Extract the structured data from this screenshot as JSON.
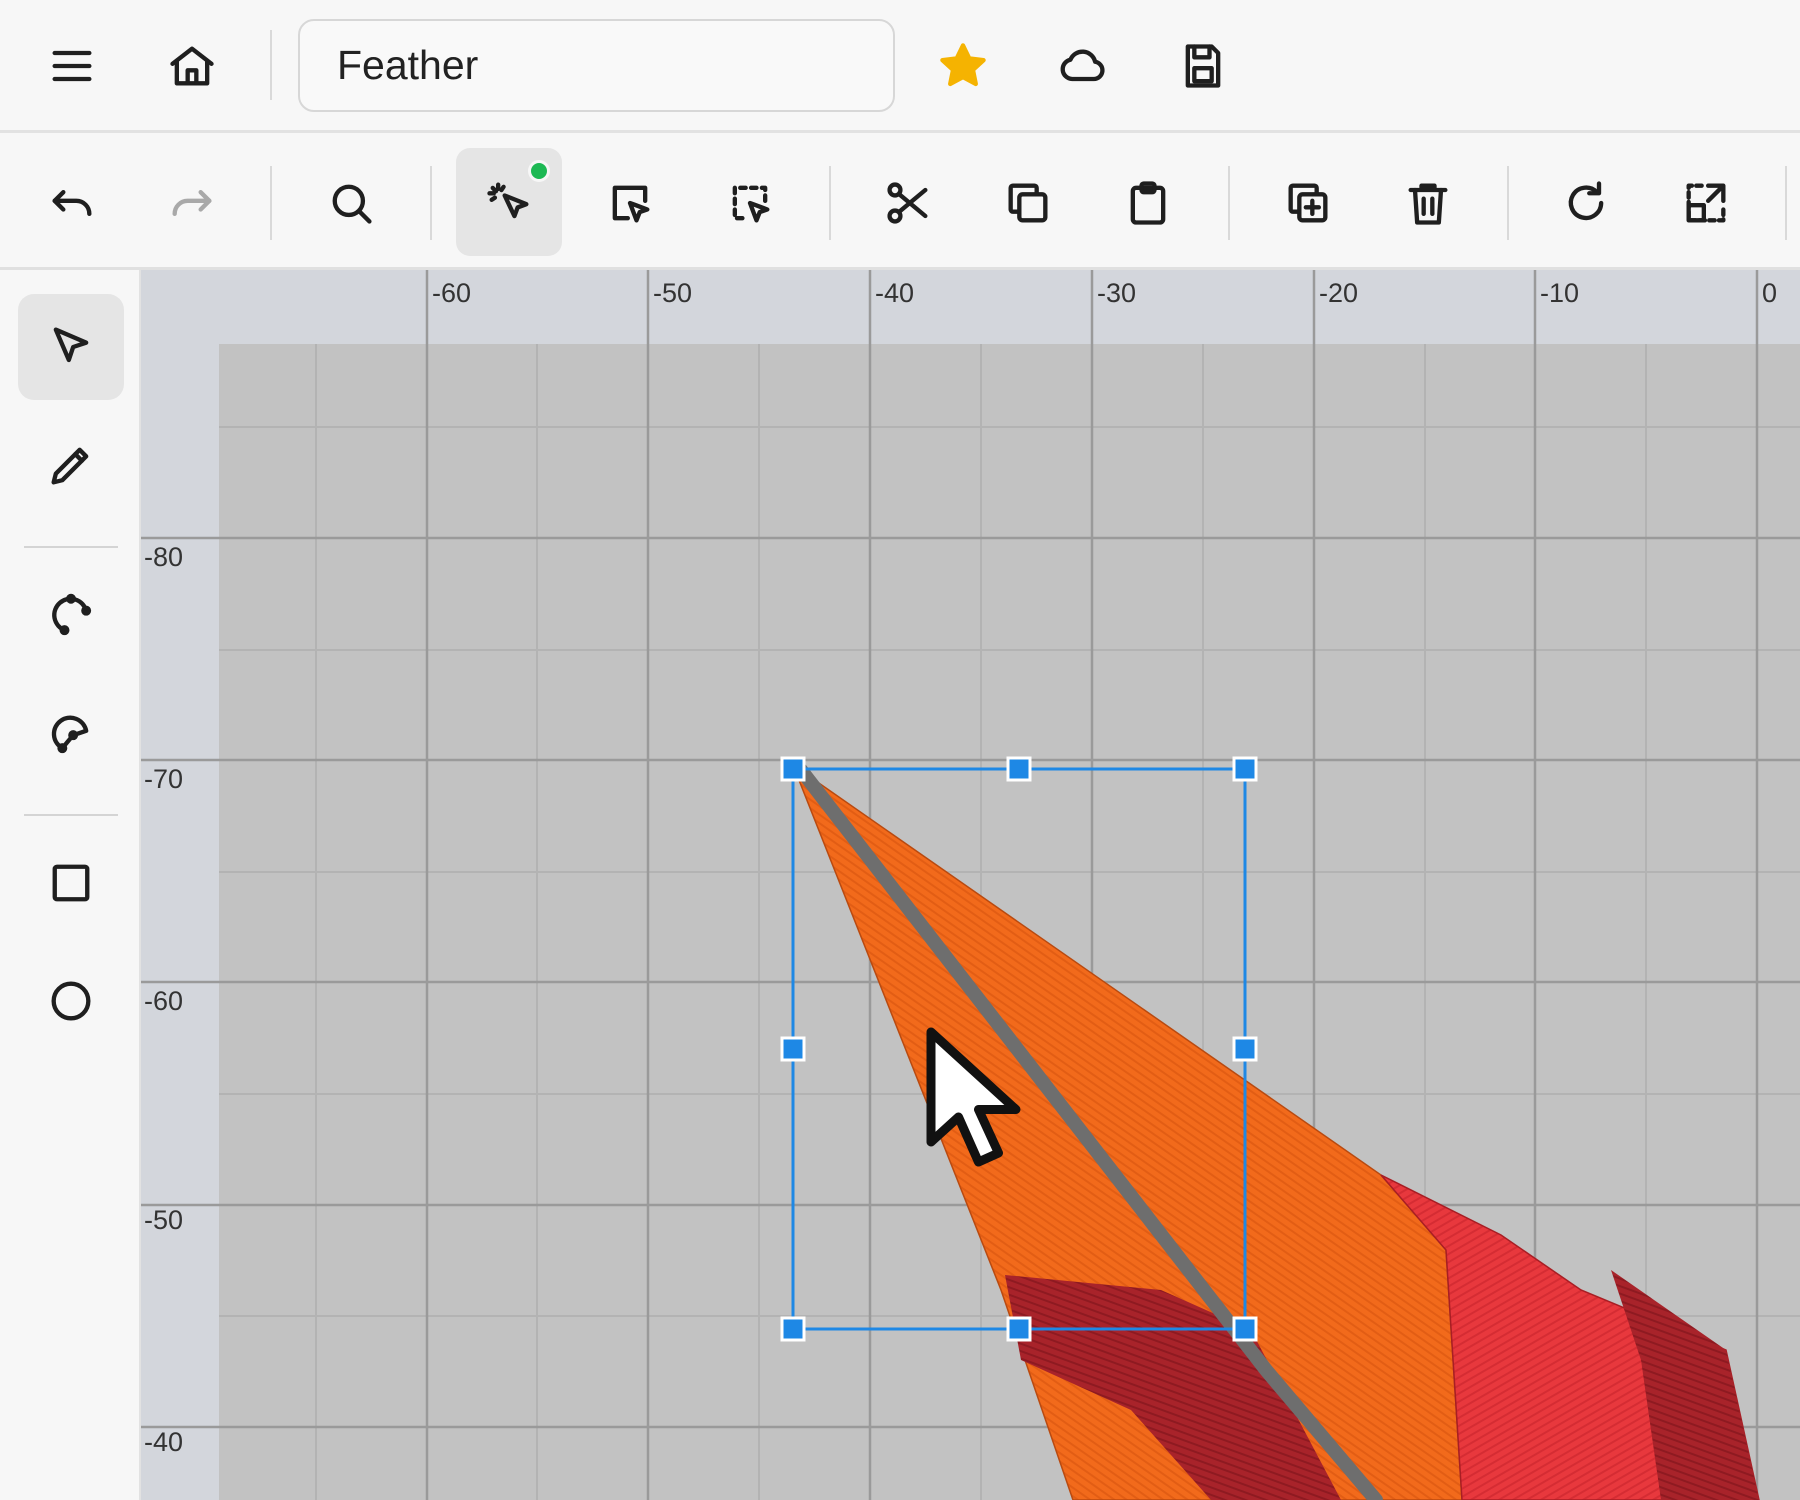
{
  "topbar": {
    "title_value": "Feather",
    "icons": [
      "menu-icon",
      "home-icon",
      "star-icon",
      "cloud-icon",
      "save-icon"
    ],
    "star_color": "#f5b301"
  },
  "toolbar": {
    "icons": [
      "undo-icon",
      "redo-icon",
      "search-icon",
      "magic-select-icon",
      "select-icon",
      "marquee-select-icon",
      "scissors-icon",
      "copy-icon",
      "paste-icon",
      "duplicate-icon",
      "delete-icon",
      "rotate-icon",
      "resize-icon"
    ],
    "active_tool": "magic-select-icon",
    "status_dot_color": "#1db954"
  },
  "left_tools": {
    "icons": [
      "pointer-icon",
      "pencil-icon",
      "open-curve-icon",
      "closed-curve-icon",
      "rectangle-icon",
      "circle-icon"
    ],
    "active_tool": "pointer-icon"
  },
  "canvas": {
    "ruler_x_labels": [
      "-60",
      "-50",
      "-40",
      "-30",
      "-20",
      "-10",
      "0"
    ],
    "ruler_y_labels": [
      "-80",
      "-70",
      "-60",
      "-50",
      "-40"
    ],
    "selection_color": "#1e88e5",
    "fill_colors": {
      "orange": "#f26a1b",
      "red": "#e8383d",
      "dark_red": "#a8232a",
      "quill": "#6e6e6e"
    }
  }
}
